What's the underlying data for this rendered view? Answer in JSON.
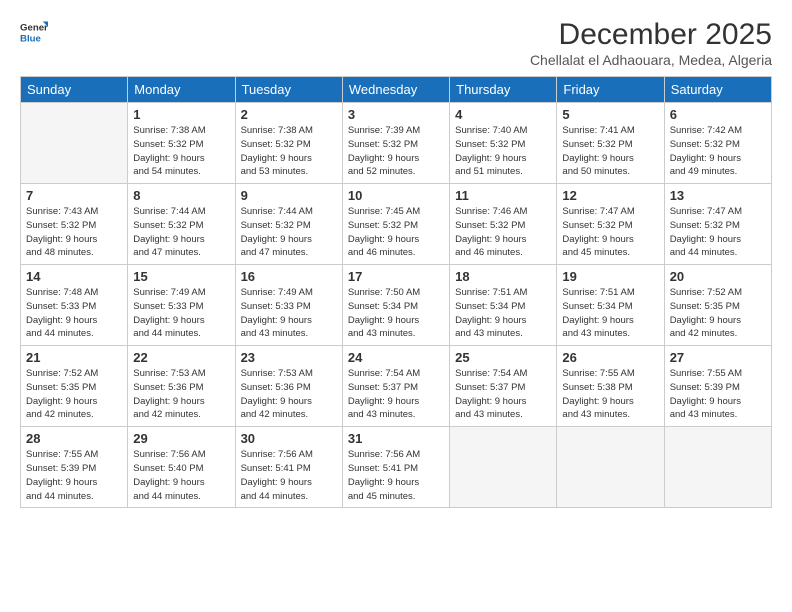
{
  "logo": {
    "general": "General",
    "blue": "Blue"
  },
  "title": "December 2025",
  "subtitle": "Chellalat el Adhaouara, Medea, Algeria",
  "days_of_week": [
    "Sunday",
    "Monday",
    "Tuesday",
    "Wednesday",
    "Thursday",
    "Friday",
    "Saturday"
  ],
  "weeks": [
    [
      {
        "day": "",
        "info": ""
      },
      {
        "day": "1",
        "info": "Sunrise: 7:38 AM\nSunset: 5:32 PM\nDaylight: 9 hours\nand 54 minutes."
      },
      {
        "day": "2",
        "info": "Sunrise: 7:38 AM\nSunset: 5:32 PM\nDaylight: 9 hours\nand 53 minutes."
      },
      {
        "day": "3",
        "info": "Sunrise: 7:39 AM\nSunset: 5:32 PM\nDaylight: 9 hours\nand 52 minutes."
      },
      {
        "day": "4",
        "info": "Sunrise: 7:40 AM\nSunset: 5:32 PM\nDaylight: 9 hours\nand 51 minutes."
      },
      {
        "day": "5",
        "info": "Sunrise: 7:41 AM\nSunset: 5:32 PM\nDaylight: 9 hours\nand 50 minutes."
      },
      {
        "day": "6",
        "info": "Sunrise: 7:42 AM\nSunset: 5:32 PM\nDaylight: 9 hours\nand 49 minutes."
      }
    ],
    [
      {
        "day": "7",
        "info": "Sunrise: 7:43 AM\nSunset: 5:32 PM\nDaylight: 9 hours\nand 48 minutes."
      },
      {
        "day": "8",
        "info": "Sunrise: 7:44 AM\nSunset: 5:32 PM\nDaylight: 9 hours\nand 47 minutes."
      },
      {
        "day": "9",
        "info": "Sunrise: 7:44 AM\nSunset: 5:32 PM\nDaylight: 9 hours\nand 47 minutes."
      },
      {
        "day": "10",
        "info": "Sunrise: 7:45 AM\nSunset: 5:32 PM\nDaylight: 9 hours\nand 46 minutes."
      },
      {
        "day": "11",
        "info": "Sunrise: 7:46 AM\nSunset: 5:32 PM\nDaylight: 9 hours\nand 46 minutes."
      },
      {
        "day": "12",
        "info": "Sunrise: 7:47 AM\nSunset: 5:32 PM\nDaylight: 9 hours\nand 45 minutes."
      },
      {
        "day": "13",
        "info": "Sunrise: 7:47 AM\nSunset: 5:32 PM\nDaylight: 9 hours\nand 44 minutes."
      }
    ],
    [
      {
        "day": "14",
        "info": "Sunrise: 7:48 AM\nSunset: 5:33 PM\nDaylight: 9 hours\nand 44 minutes."
      },
      {
        "day": "15",
        "info": "Sunrise: 7:49 AM\nSunset: 5:33 PM\nDaylight: 9 hours\nand 44 minutes."
      },
      {
        "day": "16",
        "info": "Sunrise: 7:49 AM\nSunset: 5:33 PM\nDaylight: 9 hours\nand 43 minutes."
      },
      {
        "day": "17",
        "info": "Sunrise: 7:50 AM\nSunset: 5:34 PM\nDaylight: 9 hours\nand 43 minutes."
      },
      {
        "day": "18",
        "info": "Sunrise: 7:51 AM\nSunset: 5:34 PM\nDaylight: 9 hours\nand 43 minutes."
      },
      {
        "day": "19",
        "info": "Sunrise: 7:51 AM\nSunset: 5:34 PM\nDaylight: 9 hours\nand 43 minutes."
      },
      {
        "day": "20",
        "info": "Sunrise: 7:52 AM\nSunset: 5:35 PM\nDaylight: 9 hours\nand 42 minutes."
      }
    ],
    [
      {
        "day": "21",
        "info": "Sunrise: 7:52 AM\nSunset: 5:35 PM\nDaylight: 9 hours\nand 42 minutes."
      },
      {
        "day": "22",
        "info": "Sunrise: 7:53 AM\nSunset: 5:36 PM\nDaylight: 9 hours\nand 42 minutes."
      },
      {
        "day": "23",
        "info": "Sunrise: 7:53 AM\nSunset: 5:36 PM\nDaylight: 9 hours\nand 42 minutes."
      },
      {
        "day": "24",
        "info": "Sunrise: 7:54 AM\nSunset: 5:37 PM\nDaylight: 9 hours\nand 43 minutes."
      },
      {
        "day": "25",
        "info": "Sunrise: 7:54 AM\nSunset: 5:37 PM\nDaylight: 9 hours\nand 43 minutes."
      },
      {
        "day": "26",
        "info": "Sunrise: 7:55 AM\nSunset: 5:38 PM\nDaylight: 9 hours\nand 43 minutes."
      },
      {
        "day": "27",
        "info": "Sunrise: 7:55 AM\nSunset: 5:39 PM\nDaylight: 9 hours\nand 43 minutes."
      }
    ],
    [
      {
        "day": "28",
        "info": "Sunrise: 7:55 AM\nSunset: 5:39 PM\nDaylight: 9 hours\nand 44 minutes."
      },
      {
        "day": "29",
        "info": "Sunrise: 7:56 AM\nSunset: 5:40 PM\nDaylight: 9 hours\nand 44 minutes."
      },
      {
        "day": "30",
        "info": "Sunrise: 7:56 AM\nSunset: 5:41 PM\nDaylight: 9 hours\nand 44 minutes."
      },
      {
        "day": "31",
        "info": "Sunrise: 7:56 AM\nSunset: 5:41 PM\nDaylight: 9 hours\nand 45 minutes."
      },
      {
        "day": "",
        "info": ""
      },
      {
        "day": "",
        "info": ""
      },
      {
        "day": "",
        "info": ""
      }
    ]
  ]
}
